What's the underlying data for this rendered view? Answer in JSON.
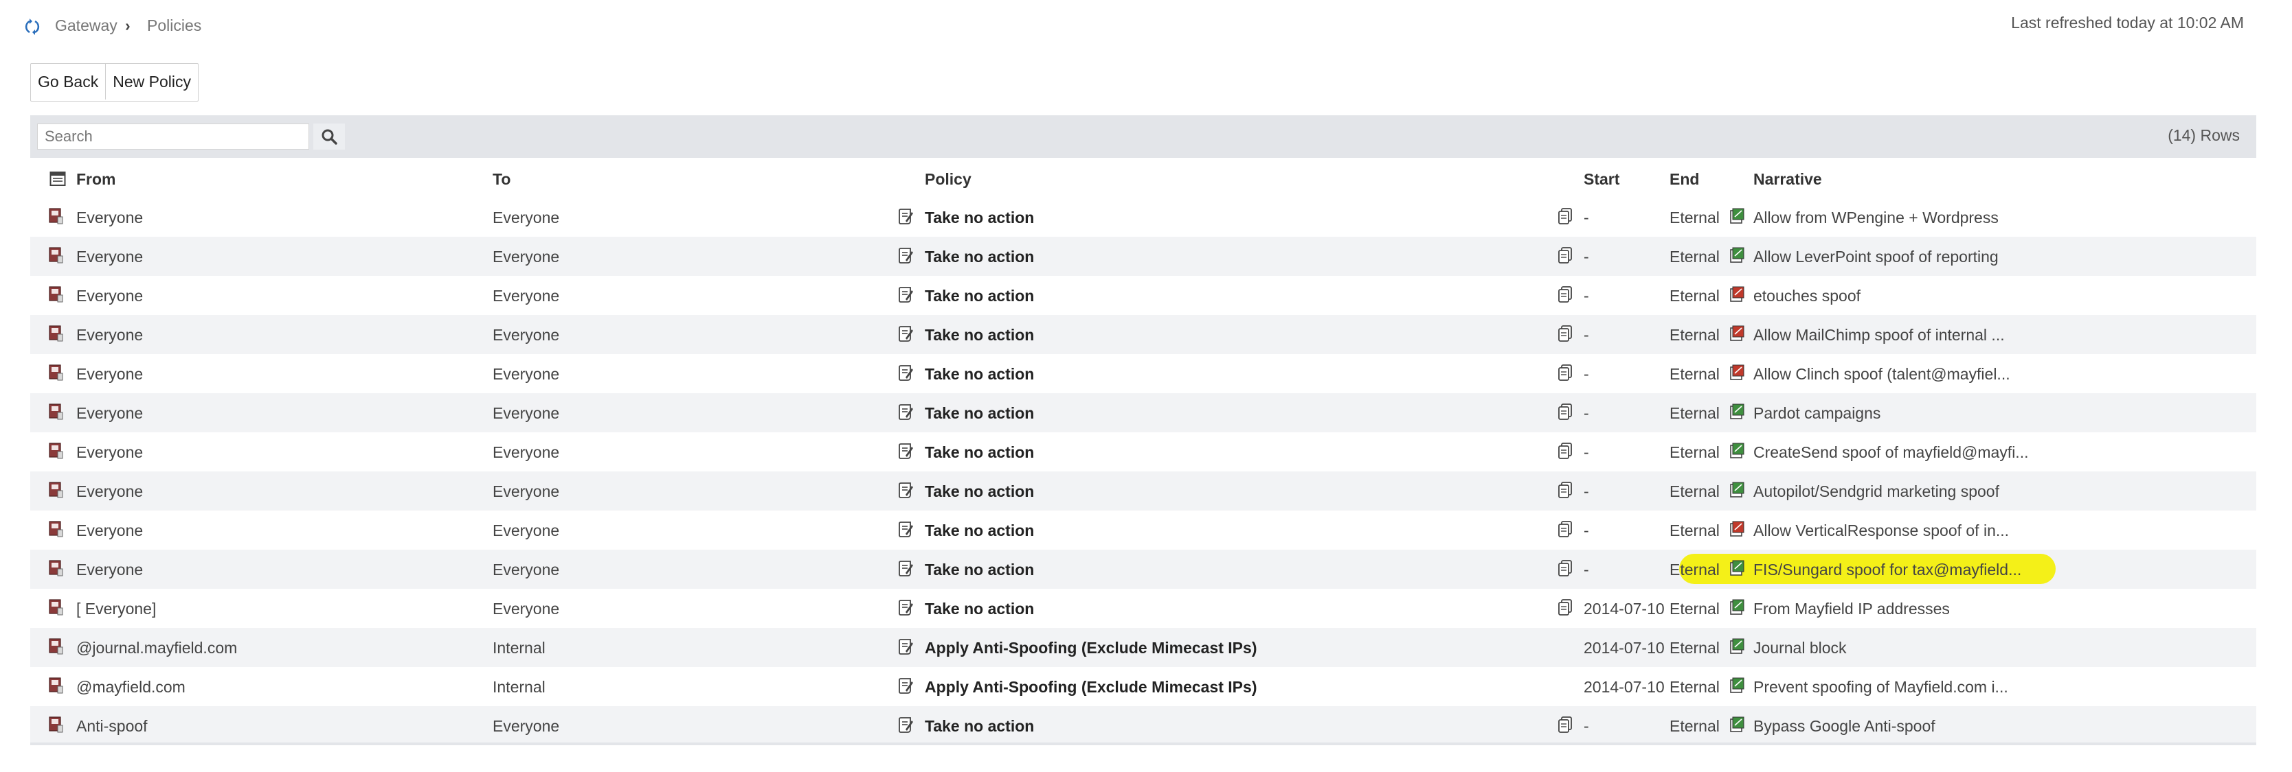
{
  "breadcrumb": {
    "root": "Gateway",
    "separator": "›",
    "current": "Policies"
  },
  "status": {
    "last_refreshed": "Last refreshed today at 10:02 AM"
  },
  "toolbar": {
    "go_back": "Go Back",
    "new_policy": "New Policy"
  },
  "search": {
    "placeholder": "Search",
    "row_count": "(14) Rows"
  },
  "columns": {
    "from": "From",
    "to": "To",
    "policy": "Policy",
    "start": "Start",
    "end": "End",
    "narrative": "Narrative"
  },
  "icons": {
    "calendar": "calendar-icon",
    "from": "red-book-icon",
    "policy": "edit-scroll-icon",
    "start": "copy-document-icon",
    "narrative_ok": "green-note-icon",
    "narrative_err": "red-note-icon"
  },
  "colors": {
    "accent": "#2a6ebb",
    "highlight": "#f4f000",
    "stripe": "#f2f3f5",
    "toolbar_bg": "#e3e5e9"
  },
  "rows": [
    {
      "from": "Everyone",
      "to": "Everyone",
      "policy": "Take no action",
      "start": "-",
      "end": "Eternal",
      "narrative": "Allow from WPengine + Wordpress",
      "status": "ok"
    },
    {
      "from": "Everyone",
      "to": "Everyone",
      "policy": "Take no action",
      "start": "-",
      "end": "Eternal",
      "narrative": "Allow LeverPoint spoof of reporting",
      "status": "ok"
    },
    {
      "from": "Everyone",
      "to": "Everyone",
      "policy": "Take no action",
      "start": "-",
      "end": "Eternal",
      "narrative": "etouches spoof",
      "status": "err"
    },
    {
      "from": "Everyone",
      "to": "Everyone",
      "policy": "Take no action",
      "start": "-",
      "end": "Eternal",
      "narrative": "Allow MailChimp spoof of internal ...",
      "status": "err"
    },
    {
      "from": "Everyone",
      "to": "Everyone",
      "policy": "Take no action",
      "start": "-",
      "end": "Eternal",
      "narrative": "Allow Clinch spoof (talent@mayfiel...",
      "status": "err"
    },
    {
      "from": "Everyone",
      "to": "Everyone",
      "policy": "Take no action",
      "start": "-",
      "end": "Eternal",
      "narrative": "Pardot campaigns",
      "status": "ok"
    },
    {
      "from": "Everyone",
      "to": "Everyone",
      "policy": "Take no action",
      "start": "-",
      "end": "Eternal",
      "narrative": "CreateSend spoof of mayfield@mayfi...",
      "status": "ok"
    },
    {
      "from": "Everyone",
      "to": "Everyone",
      "policy": "Take no action",
      "start": "-",
      "end": "Eternal",
      "narrative": "Autopilot/Sendgrid marketing spoof",
      "status": "ok"
    },
    {
      "from": "Everyone",
      "to": "Everyone",
      "policy": "Take no action",
      "start": "-",
      "end": "Eternal",
      "narrative": "Allow VerticalResponse spoof of in...",
      "status": "err"
    },
    {
      "from": "Everyone",
      "to": "Everyone",
      "policy": "Take no action",
      "start": "-",
      "end": "Eternal",
      "narrative": "FIS/Sungard spoof for tax@mayfield...",
      "status": "ok",
      "highlighted": true
    },
    {
      "from": "[ Everyone]",
      "to": "Everyone",
      "policy": "Take no action",
      "start": "2014-07-10",
      "end": "Eternal",
      "narrative": "From Mayfield IP addresses",
      "status": "ok"
    },
    {
      "from": "@journal.mayfield.com",
      "to": "Internal",
      "policy": "Apply Anti-Spoofing (Exclude Mimecast IPs)",
      "start": "2014-07-10",
      "end": "Eternal",
      "narrative": "Journal block",
      "status": "ok",
      "no_start_icon": true
    },
    {
      "from": "@mayfield.com",
      "to": "Internal",
      "policy": "Apply Anti-Spoofing (Exclude Mimecast IPs)",
      "start": "2014-07-10",
      "end": "Eternal",
      "narrative": "Prevent spoofing of Mayfield.com i...",
      "status": "ok",
      "no_start_icon": true
    },
    {
      "from": "Anti-spoof",
      "to": "Everyone",
      "policy": "Take no action",
      "start": "-",
      "end": "Eternal",
      "narrative": "Bypass Google Anti-spoof",
      "status": "ok"
    }
  ]
}
